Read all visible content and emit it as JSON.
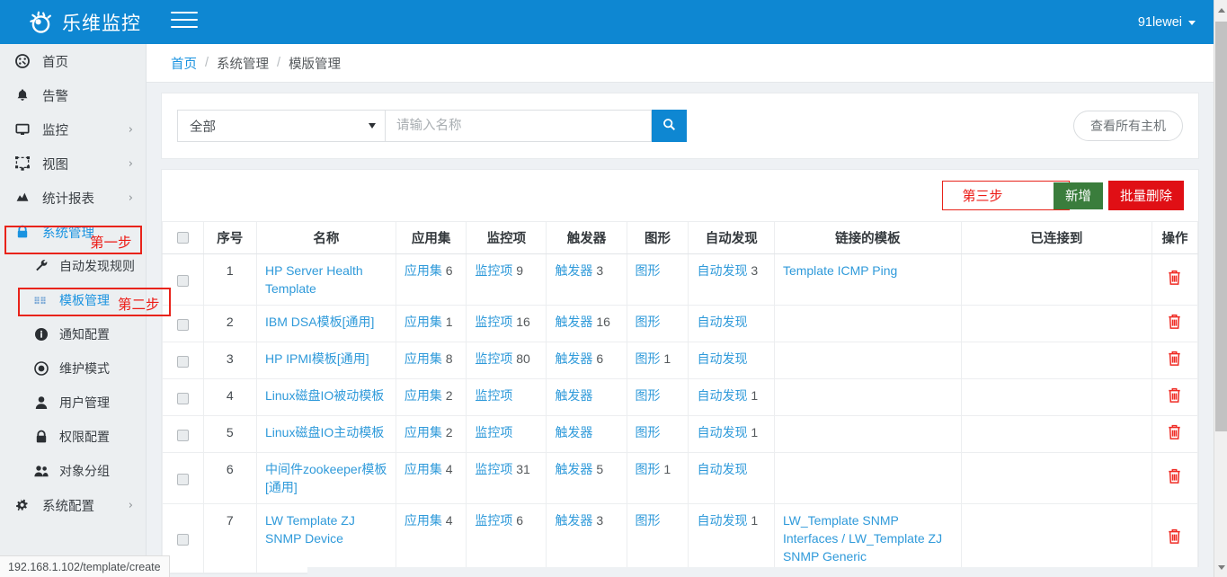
{
  "header": {
    "brand": "乐维监控",
    "logo_icon": "eye-radar-logo-icon",
    "menu_toggle_icon": "hamburger-icon",
    "user": "91lewei",
    "user_caret_icon": "caret-down-icon",
    "accent_color": "#0e87d2"
  },
  "sidebar": {
    "items": [
      {
        "label": "首页",
        "icon": "dashboard-icon",
        "chevron": "",
        "active": false
      },
      {
        "label": "告警",
        "icon": "bell-icon",
        "chevron": "",
        "active": false
      },
      {
        "label": "监控",
        "icon": "monitor-icon",
        "chevron": "›",
        "active": false
      },
      {
        "label": "视图",
        "icon": "topology-icon",
        "chevron": "›",
        "active": false
      },
      {
        "label": "统计报表",
        "icon": "chart-area-icon",
        "chevron": "›",
        "active": false
      },
      {
        "label": "系统管理",
        "icon": "lock-icon",
        "chevron": "",
        "active": true
      }
    ],
    "sub_items": [
      {
        "label": "自动发现规则",
        "icon": "wrench-icon",
        "active": false
      },
      {
        "label": "模板管理",
        "icon": "th-list-icon",
        "active": true
      },
      {
        "label": "通知配置",
        "icon": "info-circle-icon",
        "active": false
      },
      {
        "label": "维护模式",
        "icon": "dot-circle-icon",
        "active": false
      },
      {
        "label": "用户管理",
        "icon": "user-icon",
        "active": false
      },
      {
        "label": "权限配置",
        "icon": "lock-icon",
        "active": false
      },
      {
        "label": "对象分组",
        "icon": "users-icon",
        "active": false
      }
    ],
    "footer_item": {
      "label": "系统配置",
      "icon": "gears-icon",
      "chevron": "›"
    }
  },
  "annotations": {
    "color": "#ec1c17",
    "step1": "第一步",
    "step2": "第二步",
    "step3": "第三步"
  },
  "breadcrumb": {
    "home": "首页",
    "sep": "/",
    "level2": "系统管理",
    "current": "模版管理"
  },
  "filter": {
    "select_value": "全部",
    "search_placeholder": "请输入名称",
    "search_value": "",
    "search_icon": "search-icon",
    "view_all_hosts": "查看所有主机"
  },
  "toolbar": {
    "add_label": "新增",
    "bulk_delete_label": "批量删除",
    "add_color": "#3a7d3c",
    "bulk_delete_color": "#e00f15"
  },
  "table": {
    "columns": [
      "",
      "序号",
      "名称",
      "应用集",
      "监控项",
      "触发器",
      "图形",
      "自动发现",
      "链接的模板",
      "已连接到",
      "操作"
    ],
    "delete_icon": "trash-icon",
    "rows": [
      {
        "index": "1",
        "name": "HP Server Health Template",
        "app_label": "应用集",
        "app_count": "6",
        "item_label": "监控项",
        "item_count": "9",
        "trigger_label": "触发器",
        "trigger_count": "3",
        "graph_label": "图形",
        "graph_count": "",
        "discovery_label": "自动发现",
        "discovery_count": "3",
        "linked_templates": "Template ICMP Ping",
        "connected_to": ""
      },
      {
        "index": "2",
        "name": "IBM DSA模板[通用]",
        "app_label": "应用集",
        "app_count": "1",
        "item_label": "监控项",
        "item_count": "16",
        "trigger_label": "触发器",
        "trigger_count": "16",
        "graph_label": "图形",
        "graph_count": "",
        "discovery_label": "自动发现",
        "discovery_count": "",
        "linked_templates": "",
        "connected_to": ""
      },
      {
        "index": "3",
        "name": "HP IPMI模板[通用]",
        "app_label": "应用集",
        "app_count": "8",
        "item_label": "监控项",
        "item_count": "80",
        "trigger_label": "触发器",
        "trigger_count": "6",
        "graph_label": "图形",
        "graph_count": "1",
        "discovery_label": "自动发现",
        "discovery_count": "",
        "linked_templates": "",
        "connected_to": ""
      },
      {
        "index": "4",
        "name": "Linux磁盘IO被动模板",
        "app_label": "应用集",
        "app_count": "2",
        "item_label": "监控项",
        "item_count": "",
        "trigger_label": "触发器",
        "trigger_count": "",
        "graph_label": "图形",
        "graph_count": "",
        "discovery_label": "自动发现",
        "discovery_count": "1",
        "linked_templates": "",
        "connected_to": ""
      },
      {
        "index": "5",
        "name": "Linux磁盘IO主动模板",
        "app_label": "应用集",
        "app_count": "2",
        "item_label": "监控项",
        "item_count": "",
        "trigger_label": "触发器",
        "trigger_count": "",
        "graph_label": "图形",
        "graph_count": "",
        "discovery_label": "自动发现",
        "discovery_count": "1",
        "linked_templates": "",
        "connected_to": ""
      },
      {
        "index": "6",
        "name": "中间件zookeeper模板[通用]",
        "app_label": "应用集",
        "app_count": "4",
        "item_label": "监控项",
        "item_count": "31",
        "trigger_label": "触发器",
        "trigger_count": "5",
        "graph_label": "图形",
        "graph_count": "1",
        "discovery_label": "自动发现",
        "discovery_count": "",
        "linked_templates": "",
        "connected_to": ""
      },
      {
        "index": "7",
        "name": "LW Template ZJ SNMP Device",
        "app_label": "应用集",
        "app_count": "4",
        "item_label": "监控项",
        "item_count": "6",
        "trigger_label": "触发器",
        "trigger_count": "3",
        "graph_label": "图形",
        "graph_count": "",
        "discovery_label": "自动发现",
        "discovery_count": "1",
        "linked_templates": "LW_Template SNMP Interfaces / LW_Template ZJ SNMP Generic",
        "connected_to": ""
      }
    ]
  },
  "status_bar": {
    "url": "192.168.1.102/template/create"
  }
}
